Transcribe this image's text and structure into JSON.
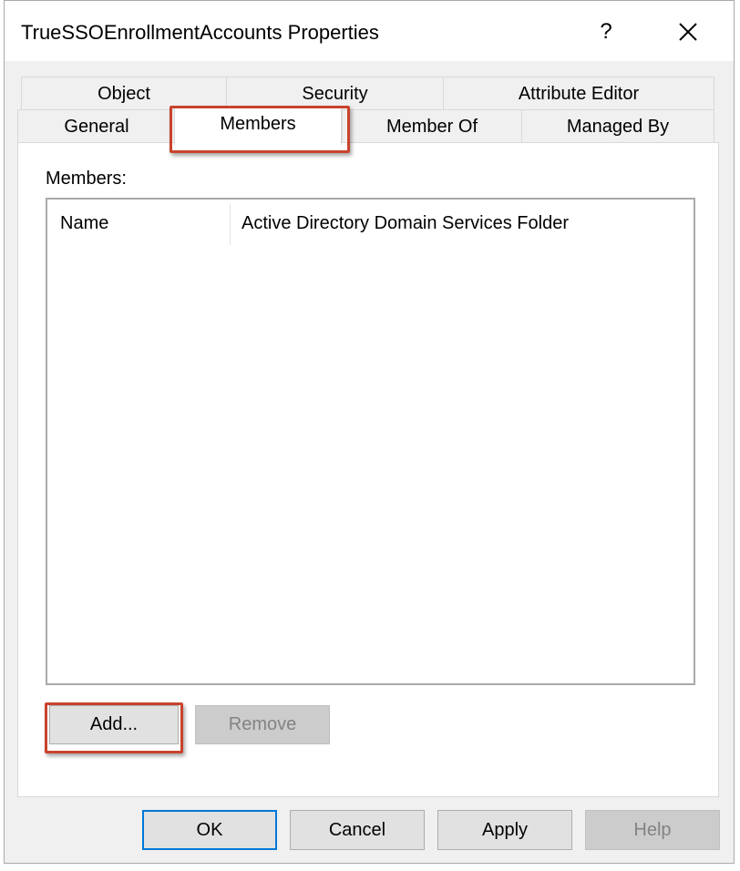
{
  "window": {
    "title": "TrueSSOEnrollmentAccounts Properties",
    "help_glyph": "?",
    "close_icon": "close-icon"
  },
  "tabs": {
    "row1": [
      {
        "label": "Object"
      },
      {
        "label": "Security"
      },
      {
        "label": "Attribute Editor"
      }
    ],
    "row2": [
      {
        "label": "General"
      },
      {
        "label": "Members",
        "active": true
      },
      {
        "label": "Member Of"
      },
      {
        "label": "Managed By"
      }
    ]
  },
  "members_panel": {
    "label": "Members:",
    "columns": [
      "Name",
      "Active Directory Domain Services Folder"
    ],
    "rows": [],
    "add_label": "Add...",
    "remove_label": "Remove"
  },
  "footer": {
    "ok_label": "OK",
    "cancel_label": "Cancel",
    "apply_label": "Apply",
    "help_label": "Help"
  },
  "colors": {
    "highlight": "#c9432d",
    "default_button_border": "#0078d7",
    "window_bg": "#f0f0f0"
  }
}
